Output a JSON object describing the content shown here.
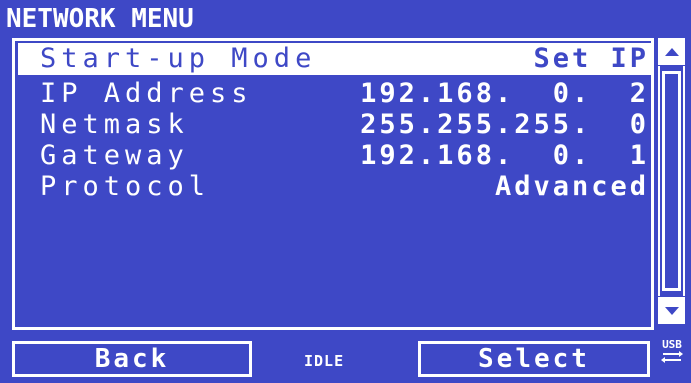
{
  "header": {
    "title": "NETWORK MENU"
  },
  "rows": [
    {
      "label": "Start-up Mode",
      "value": "Set IP",
      "selected": true
    },
    {
      "label": "IP Address",
      "value": "192.168.  0.  2"
    },
    {
      "label": "Netmask",
      "value": "255.255.255.  0"
    },
    {
      "label": "Gateway",
      "value": "192.168.  0.  1"
    },
    {
      "label": "Protocol",
      "value": "Advanced"
    }
  ],
  "footer": {
    "back_label": "Back",
    "status": "IDLE",
    "select_label": "Select",
    "usb_label": "USB"
  },
  "colors": {
    "background": "#3e48c6",
    "foreground": "#ffffff"
  }
}
